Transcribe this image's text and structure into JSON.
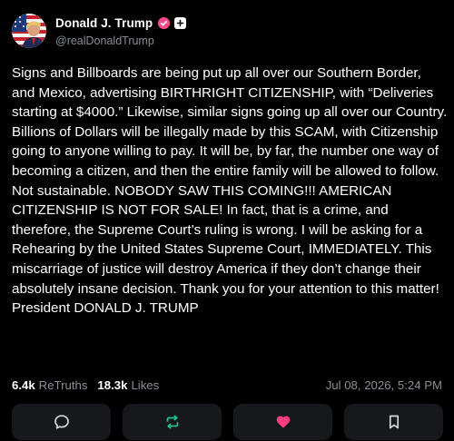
{
  "author": {
    "display_name": "Donald J. Trump",
    "handle": "@realDonaldTrump",
    "avatar_icon": "avatar-flag-portrait",
    "verified_color": "#ff4b8b"
  },
  "post": {
    "text": "Signs and Billboards are being put up all over our Southern Border, and Mexico, advertising BIRTHRIGHT CITIZENSHIP, with “Deliveries starting at $4000.” Likewise, similar signs going up all over our Country. Billions of Dollars will be illegally made by this SCAM, with Citizenship going to anyone willing to pay. It will be, by far, the number one way of becoming a citizen, and then the entire family will be allowed to follow. Not sustainable. NOBODY SAW THIS COMING!!! AMERICAN CITIZENSHIP IS NOT FOR SALE! In fact, that is a crime, and therefore, the Supreme Court’s ruling is wrong. I will be asking for a Rehearing by the United States Supreme Court, IMMEDIATELY. This miscarriage of justice will destroy America if they don’t change their absolutely insane decision. Thank you for your attention to this matter! President DONALD J. TRUMP"
  },
  "stats": {
    "retruths_count": "6.4k",
    "retruths_label": "ReTruths",
    "likes_count": "18.3k",
    "likes_label": "Likes",
    "timestamp": "Jul 08, 2026, 5:24 PM"
  },
  "actions": [
    {
      "icon": "reply-bubble-icon"
    },
    {
      "icon": "retruth-arrows-icon",
      "color": "#1ec28b"
    },
    {
      "icon": "heart-icon",
      "color": "#ff3d7f"
    },
    {
      "icon": "bookmark-icon"
    }
  ],
  "colors": {
    "background": "#000000",
    "muted_text": "#8a8d93",
    "button_bg": "#17181c"
  }
}
